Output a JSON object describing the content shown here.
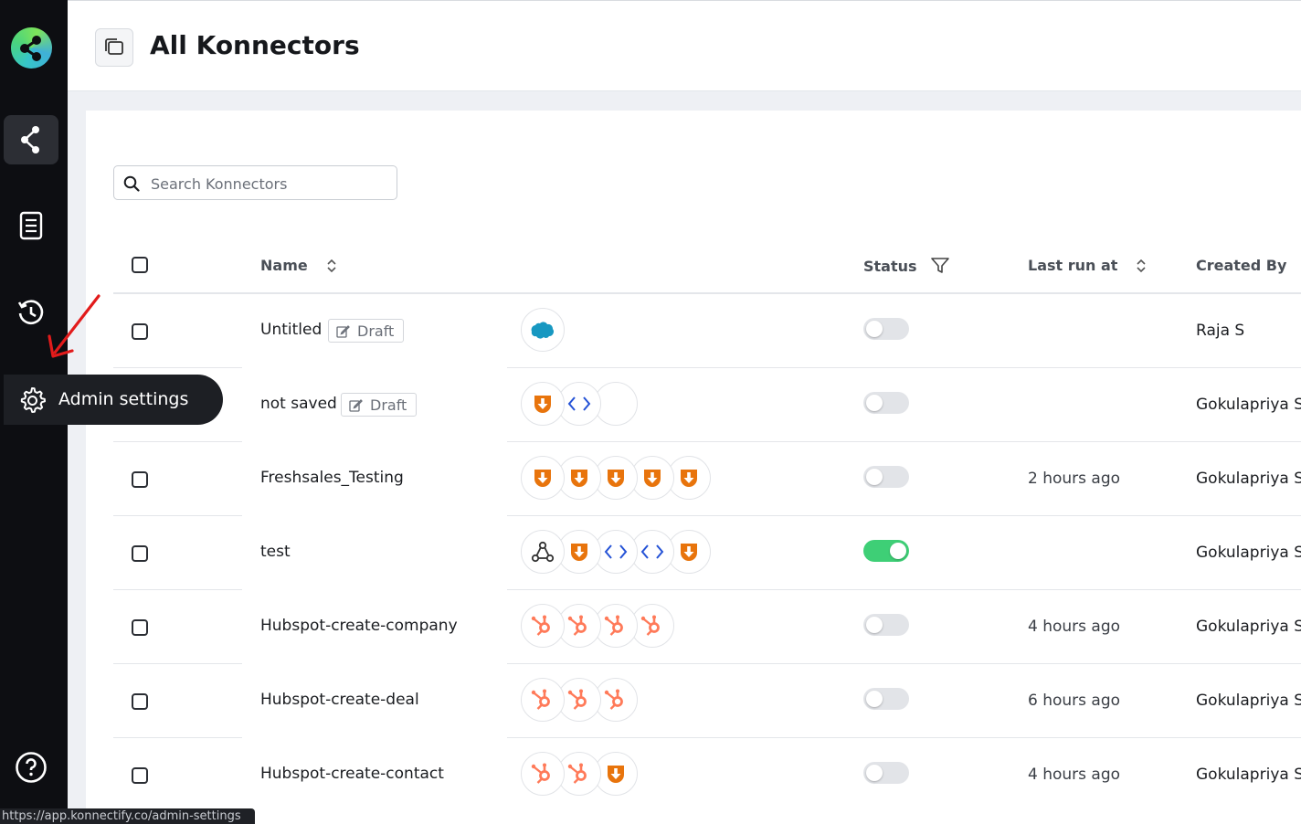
{
  "sidebar": {
    "logo": "konnectify-share-logo",
    "items": [
      {
        "icon": "share-nodes-icon",
        "active": true
      },
      {
        "icon": "document-list-icon",
        "active": false
      },
      {
        "icon": "history-icon",
        "active": false
      },
      {
        "icon": "gear-icon",
        "active": false
      }
    ],
    "help_icon": "help-circle-icon",
    "tooltip": "Admin settings"
  },
  "header": {
    "icon": "copy-pages-icon",
    "title": "All Konnectors"
  },
  "search": {
    "placeholder": "Search Konnectors"
  },
  "table": {
    "columns": {
      "name": "Name",
      "status": "Status",
      "last_run": "Last run at",
      "created_by": "Created By"
    },
    "rows": [
      {
        "name": "Untitled",
        "draft": "Draft",
        "apps": [
          "salesforce"
        ],
        "status_on": false,
        "last_run": "",
        "created_by": "Raja S"
      },
      {
        "name": "not saved",
        "draft": "Draft",
        "apps": [
          "freshsales",
          "code",
          "blank"
        ],
        "status_on": false,
        "last_run": "",
        "created_by": "Gokulapriya S"
      },
      {
        "name": "Freshsales_Testing",
        "draft": "",
        "apps": [
          "freshsales",
          "freshsales",
          "freshsales",
          "freshsales",
          "freshsales"
        ],
        "status_on": false,
        "last_run": "2 hours ago",
        "created_by": "Gokulapriya S"
      },
      {
        "name": "test",
        "draft": "",
        "apps": [
          "webhook",
          "freshsales",
          "code",
          "code",
          "freshsales"
        ],
        "status_on": true,
        "last_run": "",
        "created_by": "Gokulapriya S"
      },
      {
        "name": "Hubspot-create-company",
        "draft": "",
        "apps": [
          "hubspot",
          "hubspot",
          "hubspot",
          "hubspot"
        ],
        "status_on": false,
        "last_run": "4 hours ago",
        "created_by": "Gokulapriya S"
      },
      {
        "name": "Hubspot-create-deal",
        "draft": "",
        "apps": [
          "hubspot",
          "hubspot",
          "hubspot"
        ],
        "status_on": false,
        "last_run": "6 hours ago",
        "created_by": "Gokulapriya S"
      },
      {
        "name": "Hubspot-create-contact",
        "draft": "",
        "apps": [
          "hubspot",
          "hubspot",
          "freshsales"
        ],
        "status_on": false,
        "last_run": "4 hours ago",
        "created_by": "Gokulapriya S"
      }
    ]
  },
  "colors": {
    "sidebar_bg": "#0d0e12",
    "toggle_on": "#3ecf76",
    "freshsales": "#e8740c",
    "hubspot": "#ff7a59",
    "salesforce": "#1798c1",
    "code": "#2452d6"
  },
  "statusbar": {
    "url": "https://app.konnectify.co/admin-settings"
  }
}
